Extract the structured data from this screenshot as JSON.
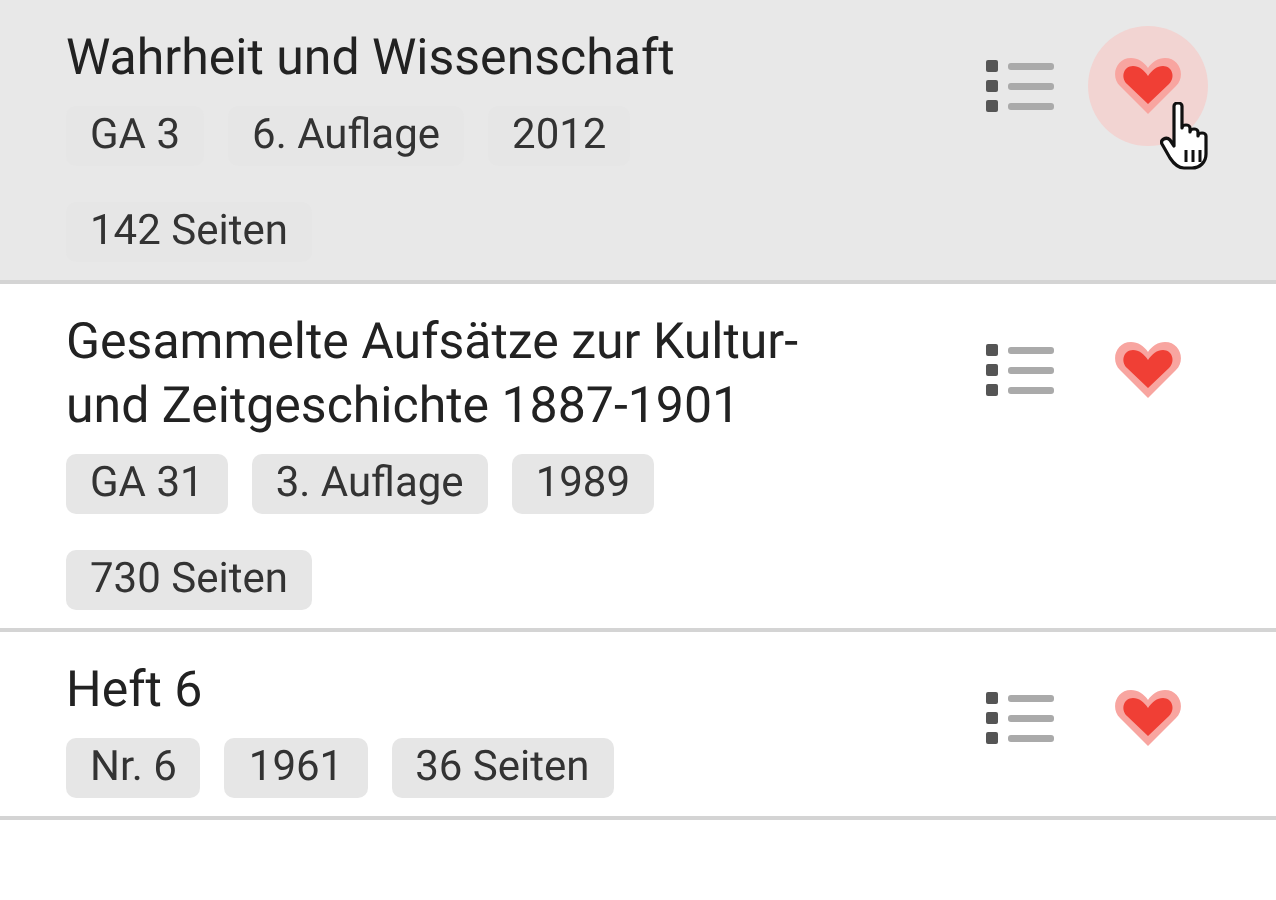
{
  "books": [
    {
      "title": "Wahrheit und Wissenschaft",
      "hovered": true,
      "tags": [
        "GA 3",
        "6. Auflage",
        "2012",
        "142 Seiten"
      ]
    },
    {
      "title": "Gesammelte Aufsätze zur Kultur- und Zeitgeschichte 1887-1901",
      "hovered": false,
      "tags": [
        "GA 31",
        "3. Auflage",
        "1989",
        "730 Seiten"
      ]
    },
    {
      "title": "Heft 6",
      "hovered": false,
      "tags": [
        "Nr. 6",
        "1961",
        "36 Seiten"
      ]
    }
  ]
}
